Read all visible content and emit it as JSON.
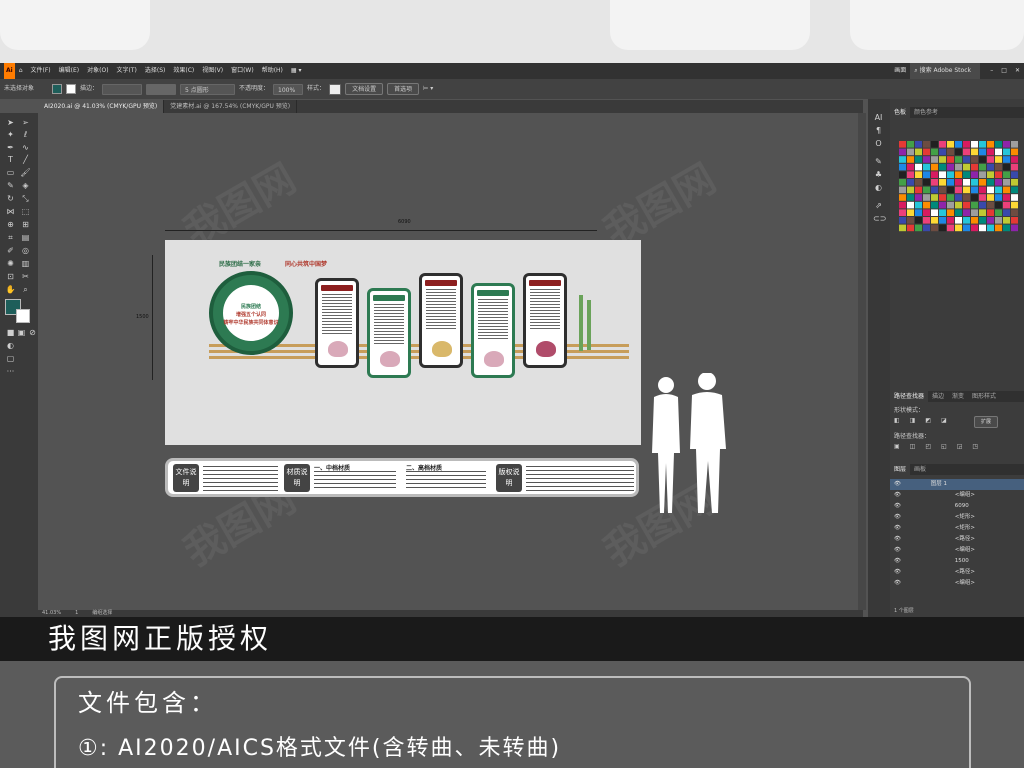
{
  "app": {
    "menu": [
      "文件(F)",
      "编辑(E)",
      "对象(O)",
      "文字(T)",
      "选择(S)",
      "效果(C)",
      "视图(V)",
      "窗口(W)",
      "帮助(H)"
    ],
    "workspace": "画面",
    "search_placeholder": "搜索 Adobe Stock"
  },
  "control_bar": {
    "selection": "未选择对象",
    "stroke_label": "描边：",
    "stroke_value": "",
    "brush": "5 点圆形",
    "opacity_label": "不透明度：",
    "opacity": "100%",
    "style_label": "样式：",
    "doc_setup": "文档设置",
    "prefs": "首选项"
  },
  "tabs": [
    {
      "label": "AI2020.ai @ 41.03% (CMYK/GPU 预览)",
      "active": true
    },
    {
      "label": "党建素材.ai @ 167.54% (CMYK/GPU 预览)",
      "active": false
    }
  ],
  "status": {
    "zoom": "41.03%",
    "page": "1",
    "mode": "编组选择"
  },
  "panels": {
    "swatches_tabs": [
      "色板",
      "颜色参考"
    ],
    "path_tabs": [
      "路径查找器",
      "描边",
      "渐变",
      "图形样式"
    ],
    "shape_modes": "形状模式：",
    "expand": "扩展",
    "path_finder": "路径查找器：",
    "layers_tabs": [
      "图层",
      "画板"
    ],
    "layers": [
      "图层 1",
      "<编组>",
      "6090",
      "<矩形>",
      "<矩形>",
      "<路径>",
      "<编组>",
      "1500",
      "<路径>",
      "<编组>"
    ],
    "layer_count": "1 个图层"
  },
  "artwork": {
    "width_dim": "6090",
    "height_dim": "1500",
    "title_left": "民族团结一家亲",
    "title_right": "同心共筑中国梦",
    "ring_text_1": "民族团结",
    "ring_text_2": "增强五个认同",
    "ring_text_3": "铸牢中华民族共同体意识",
    "info_labels": [
      "文件说明",
      "材质说明",
      "版权说明"
    ],
    "info_heads": [
      "一、中档材质",
      "二、高档材质"
    ]
  },
  "banner": "我图网正版授权",
  "footer": {
    "title": "文件包含：",
    "line1": "①: AI2020/AICS格式文件(含转曲、未转曲)"
  },
  "colors": {
    "accent": "#2d7a52",
    "red": "#b03a2e",
    "banner_bg": "#1a1a1a"
  }
}
